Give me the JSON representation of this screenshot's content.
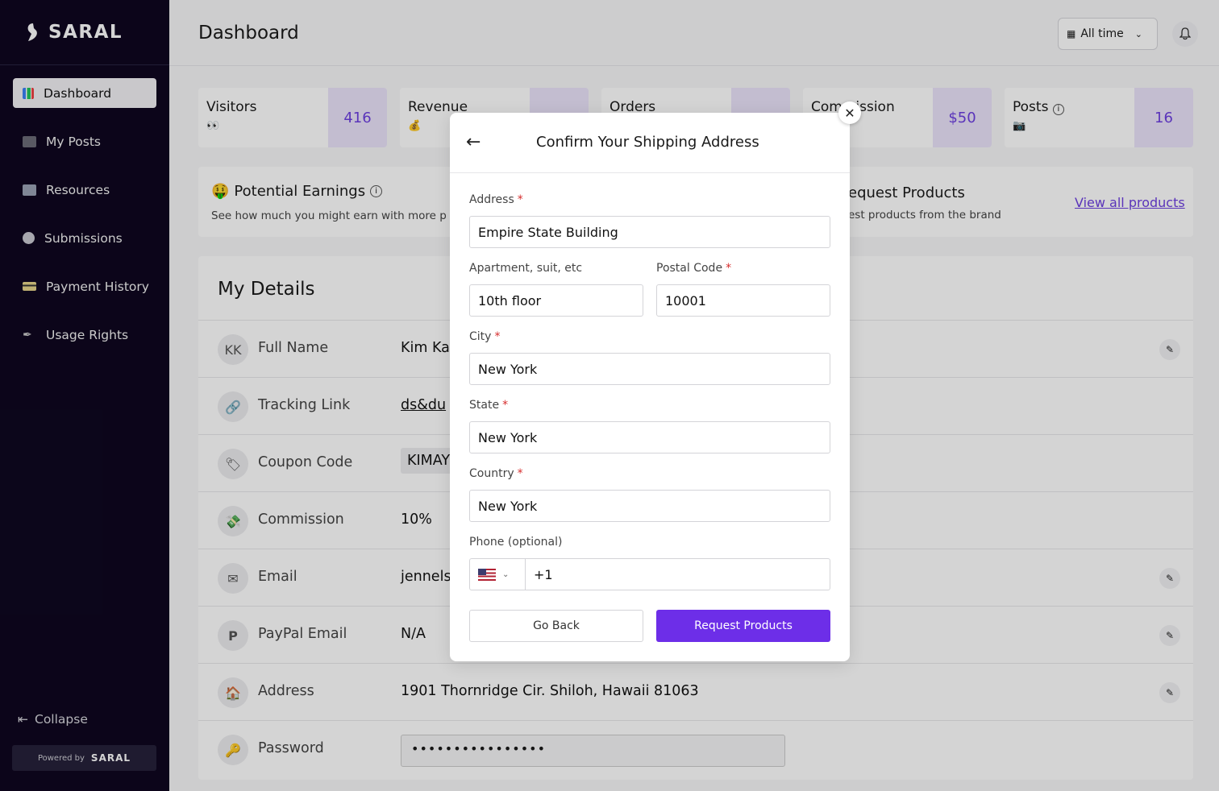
{
  "brand": {
    "name": "SARAL",
    "powered_by": "Powered by"
  },
  "sidebar": {
    "items": [
      {
        "label": "Dashboard",
        "icon": "bar-chart-icon",
        "active": true
      },
      {
        "label": "My Posts",
        "icon": "video-icon"
      },
      {
        "label": "Resources",
        "icon": "folder-icon"
      },
      {
        "label": "Submissions",
        "icon": "disc-icon"
      },
      {
        "label": "Payment History",
        "icon": "card-icon"
      },
      {
        "label": "Usage Rights",
        "icon": "pen-icon"
      }
    ],
    "collapse_label": "Collapse"
  },
  "header": {
    "title": "Dashboard",
    "time_filter": "All time"
  },
  "stats": [
    {
      "label": "Visitors",
      "emoji": "👀",
      "value": "416"
    },
    {
      "label": "Revenue",
      "emoji": "💰",
      "value": ""
    },
    {
      "label": "Orders",
      "emoji": "",
      "value": ""
    },
    {
      "label": "Commission",
      "emoji": "",
      "value": "$50"
    },
    {
      "label": "Posts",
      "emoji": "📷",
      "value": "16"
    }
  ],
  "earnings": {
    "title": "Potential Earnings",
    "emoji": "🤑",
    "subtitle": "See how much you might earn with more p",
    "request_title": "equest Products",
    "request_sub": "est products from the brand",
    "view_all": "View all products"
  },
  "details": {
    "title": "My Details",
    "rows": [
      {
        "label": "Full Name",
        "value": "Kim Ka",
        "avatar": "KK",
        "editable": true
      },
      {
        "label": "Tracking Link",
        "value": "ds&du",
        "avatar": "🔗",
        "editable": false
      },
      {
        "label": "Coupon Code",
        "value": "KIMAY",
        "avatar": "🏷",
        "editable": false
      },
      {
        "label": "Commission",
        "value": "10%",
        "avatar": "💸",
        "editable": false
      },
      {
        "label": "Email",
        "value": "jennels",
        "avatar": "✉",
        "editable": true
      },
      {
        "label": "PayPal Email",
        "value": "N/A",
        "avatar": "P",
        "editable": true
      },
      {
        "label": "Address",
        "value": "1901 Thornridge Cir. Shiloh, Hawaii 81063",
        "avatar": "🏠",
        "editable": true
      },
      {
        "label": "Password",
        "value": "••••••••••••••••",
        "avatar": "🔑",
        "editable": false
      }
    ]
  },
  "modal": {
    "title": "Confirm Your Shipping Address",
    "address_label": "Address",
    "address_value": "Empire State Building",
    "apt_label": "Apartment, suit, etc",
    "apt_value": "10th floor",
    "postal_label": "Postal Code",
    "postal_value": "10001",
    "city_label": "City",
    "city_value": "New York",
    "state_label": "State",
    "state_value": "New York",
    "country_label": "Country",
    "country_value": "New York",
    "phone_label": "Phone (optional)",
    "phone_value": "+1",
    "go_back": "Go Back",
    "request": "Request Products",
    "required_mark": "*"
  }
}
